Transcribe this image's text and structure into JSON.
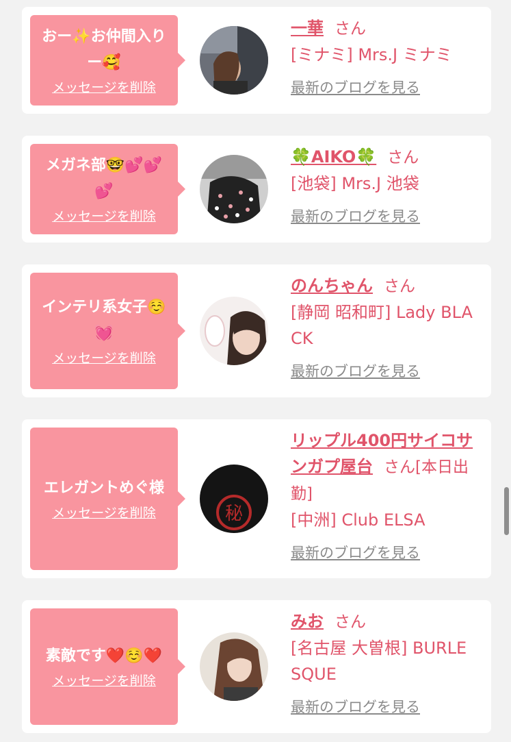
{
  "common": {
    "honorific": "さん",
    "delete_label": "メッセージを削除",
    "blog_label": "最新のブログを見る"
  },
  "cards": [
    {
      "message": "おー✨お仲間入りー🥰",
      "name": "一華",
      "shop": "[ミナミ] Mrs.J ミナミ"
    },
    {
      "message": "メガネ部🤓💕💕💕",
      "name": "🍀AIKO🍀",
      "shop": "[池袋] Mrs.J 池袋"
    },
    {
      "message": "インテリ系女子☺️💓",
      "name": "のんちゃん",
      "shop": "[静岡 昭和町] Lady BLACK"
    },
    {
      "message": "エレガントめぐ様",
      "name": "リップル400円サイコサンガプ屋台",
      "honorific_ext": "さん[本日出勤]",
      "shop": "[中洲] Club ELSA"
    },
    {
      "message": "素敵です❤️☺️❤️",
      "name": "みお",
      "shop": "[名古屋 大曽根] BURLESQUE"
    }
  ],
  "colors": {
    "background": "#f2f2f2",
    "bubble": "#f9959f",
    "accent_text": "#e0546a",
    "muted_link": "#8a8a8a"
  }
}
